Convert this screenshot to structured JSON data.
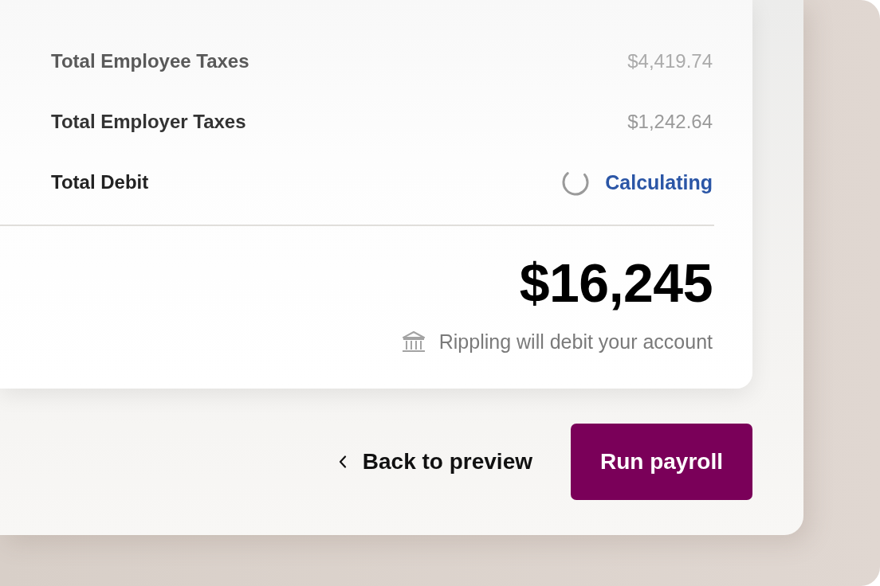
{
  "summary": {
    "rows": [
      {
        "label": "Total Employee Taxes",
        "kind": "amount",
        "value": "$4,419.74"
      },
      {
        "label": "Total Employer Taxes",
        "kind": "amount",
        "value": "$1,242.64"
      },
      {
        "label": "Total Debit",
        "kind": "pending",
        "value": "Calculating"
      }
    ]
  },
  "total": {
    "amount": "$16,245",
    "note": "Rippling will debit your account"
  },
  "actions": {
    "back": "Back to preview",
    "primary": "Run payroll"
  }
}
